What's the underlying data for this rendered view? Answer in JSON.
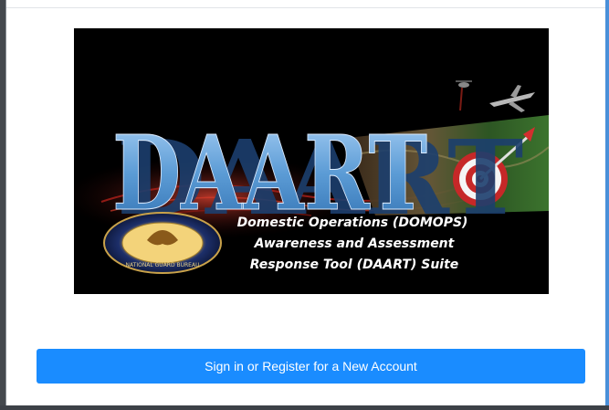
{
  "banner": {
    "logo_text": "DAART",
    "tagline": [
      "Domestic Operations (DOMOPS)",
      "Awareness and Assessment",
      "Response Tool (DAART) Suite"
    ],
    "seal_label": "NATIONAL GUARD BUREAU"
  },
  "actions": {
    "signin_label": "Sign in or Register for a New Account"
  },
  "colors": {
    "button": "#1a8cff",
    "banner_bg": "#000000",
    "logo_blue": "#5b9bd5",
    "tagline": "#ffffff"
  }
}
